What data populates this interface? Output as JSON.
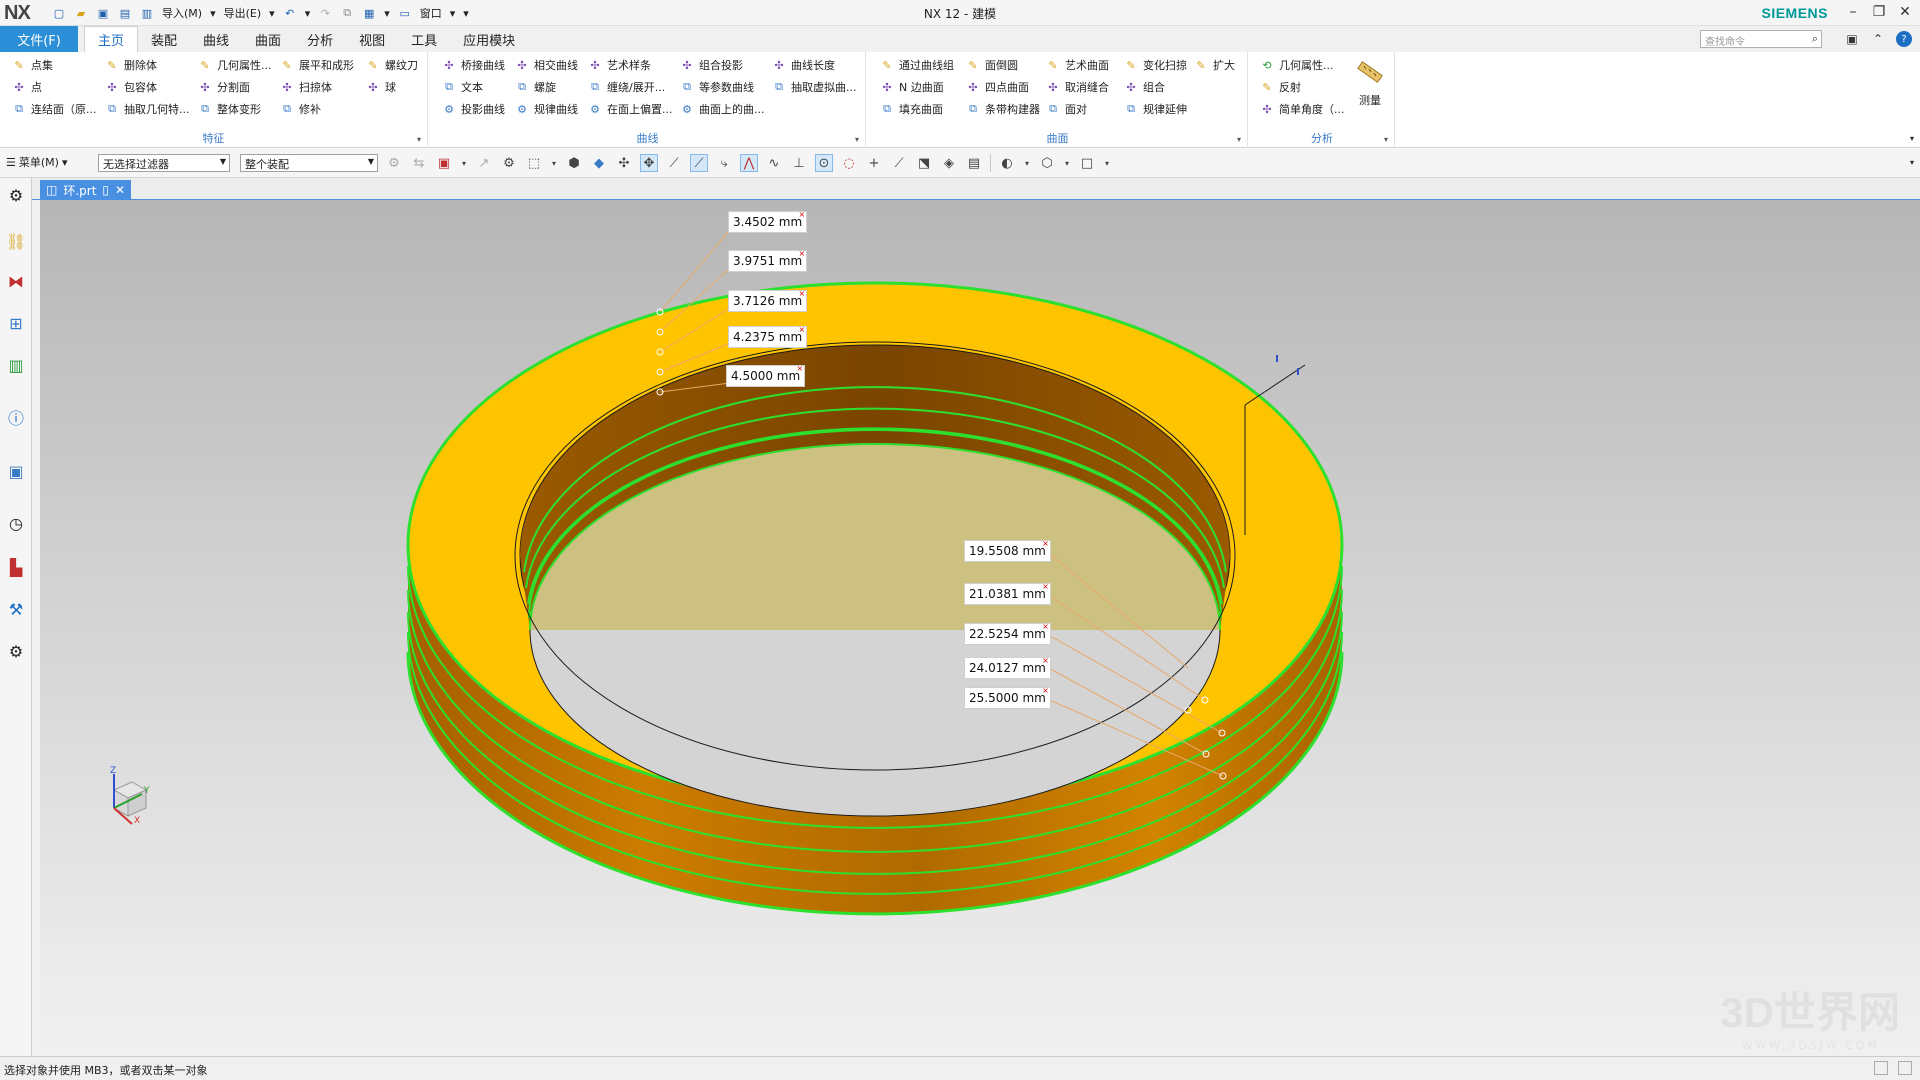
{
  "titlebar": {
    "logo": "NX",
    "title": "NX 12 - 建模",
    "brand": "SIEMENS",
    "import_label": "导入(M)",
    "export_label": "导出(E)",
    "window_label": "窗口"
  },
  "menubar": {
    "file_tab": "文件(F)",
    "tabs": [
      "主页",
      "装配",
      "曲线",
      "曲面",
      "分析",
      "视图",
      "工具",
      "应用模块"
    ],
    "active_tab": "主页",
    "search_placeholder": "查找命令"
  },
  "ribbon": {
    "features": {
      "label": "特征",
      "col1": [
        "点集",
        "点",
        "连结面（原..."
      ],
      "col2": [
        "删除体",
        "包容体",
        "抽取几何特..."
      ],
      "col3": [
        "几何属性...",
        "分割面",
        "整体变形"
      ],
      "col4": [
        "展平和成形",
        "扫掠体",
        "修补"
      ],
      "col5": [
        "螺纹刀",
        "球"
      ]
    },
    "curve": {
      "label": "曲线",
      "col1": [
        "桥接曲线",
        "文本",
        "投影曲线"
      ],
      "col2": [
        "相交曲线",
        "螺旋",
        "规律曲线"
      ],
      "col3": [
        "艺术样条",
        "缠绕/展开...",
        "在面上偏置..."
      ],
      "col4": [
        "组合投影",
        "等参数曲线",
        "曲面上的曲..."
      ],
      "col5": [
        "曲线长度",
        "抽取虚拟曲..."
      ]
    },
    "surface": {
      "label": "曲面",
      "col1": [
        "通过曲线组",
        "N 边曲面",
        "填充曲面"
      ],
      "col2": [
        "面倒圆",
        "四点曲面",
        "条带构建器"
      ],
      "col3": [
        "艺术曲面",
        "取消缝合",
        "面对"
      ],
      "col4": [
        "变化扫掠",
        "组合",
        "规律延伸"
      ],
      "col5": [
        "扩大"
      ]
    },
    "analysis": {
      "label": "分析",
      "col1": [
        "几何属性...",
        "反射",
        "简单角度（..."
      ],
      "measure": "测量"
    }
  },
  "toolbar": {
    "menu_label": "菜单(M)",
    "filter": "无选择过滤器",
    "scope": "整个装配"
  },
  "document": {
    "tab_name": "环.prt"
  },
  "dimensions": {
    "upper": [
      "3.4502 mm",
      "3.9751 mm",
      "3.7126 mm",
      "4.2375 mm",
      "4.5000 mm"
    ],
    "lower": [
      "19.5508 mm",
      "21.0381 mm",
      "22.5254 mm",
      "24.0127 mm",
      "25.5000 mm"
    ]
  },
  "triad": {
    "x": "X",
    "y": "Y",
    "z": "Z"
  },
  "watermark": {
    "main": "3D世界网",
    "sub": "WWW.3DSJW.COM"
  },
  "statusbar": {
    "message": "选择对象并使用 MB3，或者双击某一对象"
  }
}
